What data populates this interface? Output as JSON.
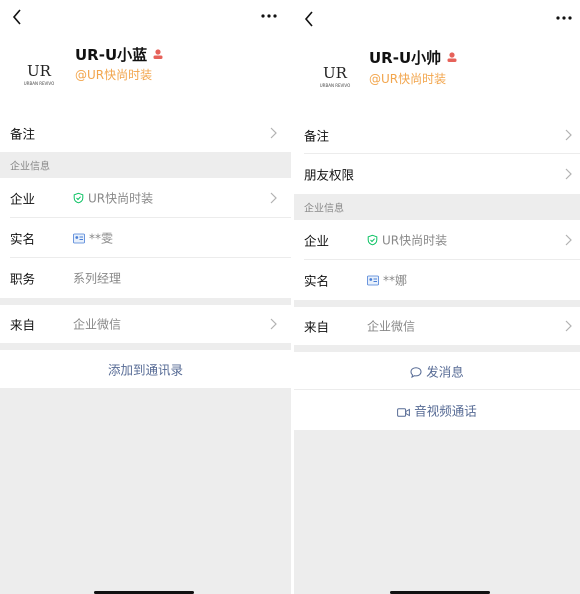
{
  "left": {
    "profile": {
      "name": "UR-U小蓝",
      "org": "@UR快尚时装",
      "logo_text": "UR",
      "logo_subtext": "URBAN REVIVO"
    },
    "rows": {
      "remark": "备注",
      "company_label": "企业",
      "company_value": "UR快尚时装",
      "realname_label": "实名",
      "realname_value": "**雯",
      "position_label": "职务",
      "position_value": "系列经理",
      "from_label": "来自",
      "from_value": "企业微信"
    },
    "section_title": "企业信息",
    "action": "添加到通讯录"
  },
  "right": {
    "profile": {
      "name": "UR-U小帅",
      "org": "@UR快尚时装",
      "logo_text": "UR",
      "logo_subtext": "URBAN REVIVO"
    },
    "rows": {
      "remark": "备注",
      "friend_perm": "朋友权限",
      "company_label": "企业",
      "company_value": "UR快尚时装",
      "realname_label": "实名",
      "realname_value": "**娜",
      "from_label": "来自",
      "from_value": "企业微信"
    },
    "section_title": "企业信息",
    "action_message": "发消息",
    "action_call": "音视频通话"
  },
  "colors": {
    "org_orange": "#f2a54c",
    "link_blue": "#576b95",
    "verify_green": "#07c160",
    "user_red": "#e6625a",
    "bg_gray": "#ededed"
  }
}
